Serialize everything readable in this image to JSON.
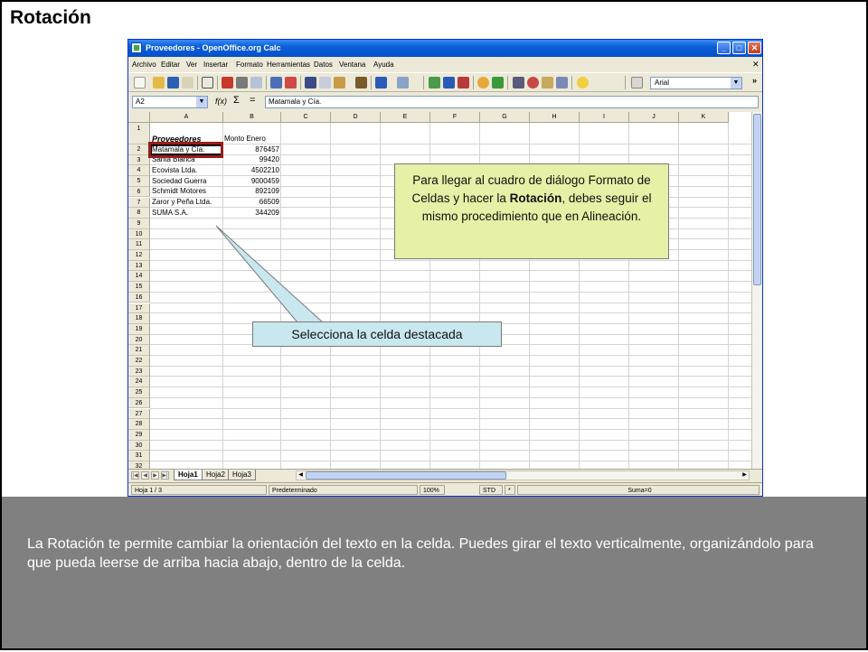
{
  "slide": {
    "title": "Rotación",
    "description": "La Rotación te permite cambiar la orientación del texto en la celda. Puedes girar el texto verticalmente, organizándolo para que pueda leerse de arriba hacia abajo, dentro de la celda."
  },
  "window": {
    "title": "Proveedores - OpenOffice.org Calc",
    "minimize": "_",
    "maximize": "□",
    "close": "✕",
    "doc_close": "✕"
  },
  "menu": [
    "Archivo",
    "Editar",
    "Ver",
    "Insertar",
    "Formato",
    "Herramientas",
    "Datos",
    "Ventana",
    "Ayuda"
  ],
  "toolbar": {
    "font_name": "Arial",
    "overflow": "»"
  },
  "formula_bar": {
    "cell_ref": "A2",
    "fx": "f(x)",
    "sum": "Σ",
    "equals": "=",
    "content": "Matamala y Cía."
  },
  "sheet": {
    "columns": [
      "A",
      "B",
      "C",
      "D",
      "E",
      "F",
      "G",
      "H",
      "I",
      "J",
      "K"
    ],
    "rows": [
      "1",
      "2",
      "3",
      "4",
      "5",
      "6",
      "7",
      "8",
      "9",
      "10",
      "11",
      "12",
      "13",
      "14",
      "15",
      "16",
      "17",
      "18",
      "19",
      "20",
      "21",
      "22",
      "23",
      "24",
      "25",
      "26",
      "27",
      "28",
      "29",
      "30",
      "31",
      "32"
    ],
    "header_a": "Proveedores",
    "header_b": "Monto Enero",
    "data": [
      {
        "name": "Matamala y Cía.",
        "amount": "876457"
      },
      {
        "name": "Santa Blanca",
        "amount": "99420"
      },
      {
        "name": "Ecovista Ltda.",
        "amount": "4502210"
      },
      {
        "name": "Sociedad Guerra",
        "amount": "9000459"
      },
      {
        "name": "Schmidt Motores",
        "amount": "892109"
      },
      {
        "name": "Zaror y Peña Ltda.",
        "amount": "66509"
      },
      {
        "name": "SUMA S.A.",
        "amount": "344209"
      }
    ]
  },
  "tabs": [
    "Hoja1",
    "Hoja2",
    "Hoja3"
  ],
  "status": {
    "sheet": "Hoja 1 / 3",
    "style": "Predeterminado",
    "zoom": "100%",
    "mode": "STD",
    "star": "*",
    "sum": "Suma=0"
  },
  "callouts": {
    "big_line1": "Para llegar al cuadro de diálogo Formato de Celdas y hacer la",
    "big_bold": "Rotación",
    "big_line2": ", debes seguir el mismo procedimiento que en Alineación.",
    "small": "Selecciona la celda destacada"
  },
  "colors": {
    "bottom_panel": "#808080",
    "callout_yellow": "#e6f0a6",
    "callout_blue": "#c9e7ee",
    "highlight_border": "#9b1c1c",
    "title_bar": "#0a5fd8"
  }
}
